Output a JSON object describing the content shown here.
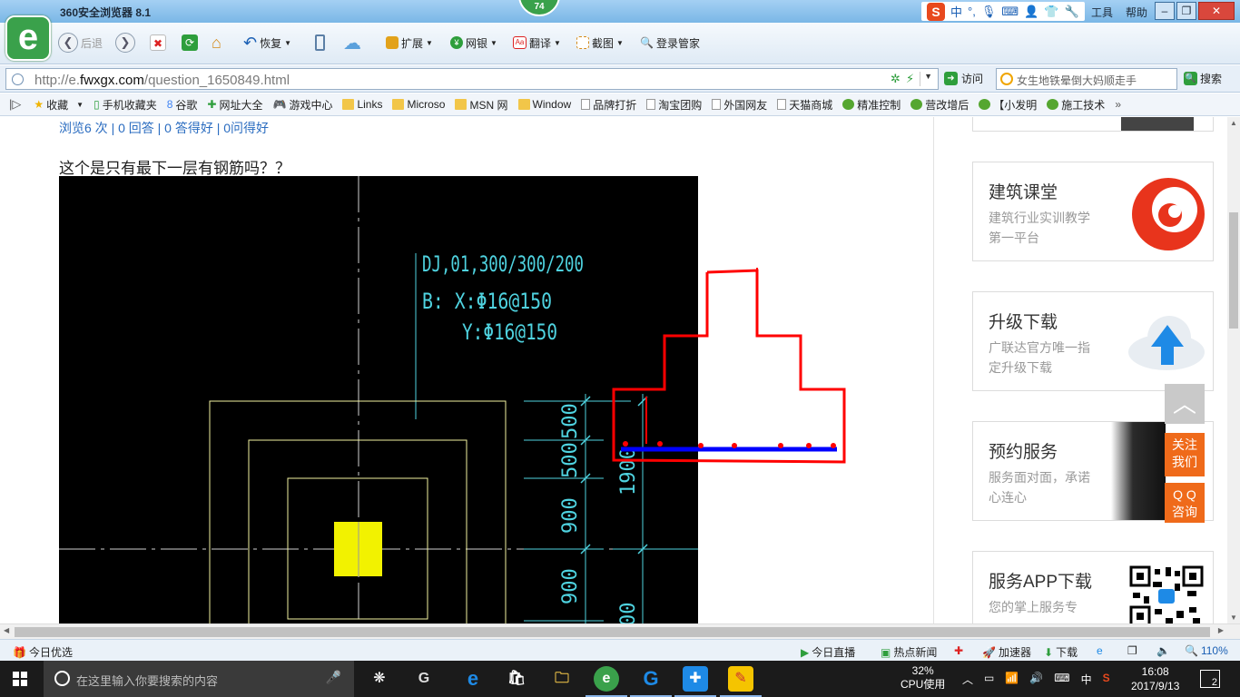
{
  "window": {
    "title": "360安全浏览器 8.1",
    "badge": "74",
    "menu": [
      "工具",
      "帮助"
    ],
    "ime": [
      "中",
      "°,"
    ]
  },
  "toolbar": {
    "back": "后退",
    "restore": "恢复",
    "extend": "扩展",
    "netbank": "网银",
    "translate": "翻译",
    "screenshot": "截图",
    "login": "登录管家"
  },
  "address": {
    "url_prefix": "http://e.",
    "url_domain": "fwxgx.com",
    "url_path": "/question_1650849.html",
    "visit": "访问",
    "search_placeholder": "女生地铁晕倒大妈顺走手",
    "search": "搜索"
  },
  "favorites": {
    "items": [
      {
        "label": "收藏",
        "icon": "star-icon"
      },
      {
        "label": "手机收藏夹",
        "icon": "phone-icon"
      },
      {
        "label": "谷歌",
        "icon": "google-icon"
      },
      {
        "label": "网址大全",
        "icon": "plus-icon"
      },
      {
        "label": "游戏中心",
        "icon": "gamepad-icon"
      },
      {
        "label": "Links",
        "icon": "folder-icon"
      },
      {
        "label": "Microso",
        "icon": "folder-icon"
      },
      {
        "label": "MSN 网",
        "icon": "folder-icon"
      },
      {
        "label": "Window",
        "icon": "folder-icon"
      },
      {
        "label": "品牌打折",
        "icon": "page-icon"
      },
      {
        "label": "淘宝团购",
        "icon": "page-icon"
      },
      {
        "label": "外国网友",
        "icon": "page-icon"
      },
      {
        "label": "天猫商城",
        "icon": "page-icon"
      },
      {
        "label": "精准控制",
        "icon": "chat-icon"
      },
      {
        "label": "营改增后",
        "icon": "chat-icon"
      },
      {
        "label": "【小发明",
        "icon": "chat-icon"
      },
      {
        "label": "施工技术",
        "icon": "chat-icon"
      }
    ],
    "more": "»"
  },
  "page": {
    "stats": "浏览6 次 | 0 回答 | 0 答得好 | 0问得好",
    "question": "这个是只有最下一层有钢筋吗？？",
    "cad": {
      "line1": "DJ,01,300/300/200",
      "line2": "B:  X:Φ16@150",
      "line3": "Y:Φ16@150",
      "dims": [
        "500",
        "500",
        "900",
        "900",
        "1900",
        "00"
      ]
    }
  },
  "sidebar": {
    "cards": [
      {
        "title": "建筑课堂",
        "desc": "建筑行业实训教学第一平台"
      },
      {
        "title": "升级下载",
        "desc": "广联达官方唯一指定升级下载"
      },
      {
        "title": "预约服务",
        "desc": "服务面对面，承诺心连心"
      },
      {
        "title": "服务APP下载",
        "desc": "您的掌上服务专"
      }
    ],
    "follow": "关注我们",
    "qq": "Q Q 咨询",
    "totop": "︿"
  },
  "statusbar": {
    "left": "今日优选",
    "live": "今日直播",
    "news": "热点新闻",
    "accel": "加速器",
    "download": "下载",
    "zoom": "110%"
  },
  "taskbar": {
    "search_placeholder": "在这里输入你要搜索的内容",
    "cpu_value": "32%",
    "cpu_label": "CPU使用",
    "time": "16:08",
    "date": "2017/9/13",
    "ime": "中",
    "notifications": "2"
  },
  "colors": {
    "accent_green": "#3aa14b",
    "cad_cyan": "#4fd3e0",
    "cad_yellow": "#f2f200",
    "sketch_red": "#ff0000",
    "sketch_blue": "#0000ff",
    "orange": "#ef6a1a"
  }
}
